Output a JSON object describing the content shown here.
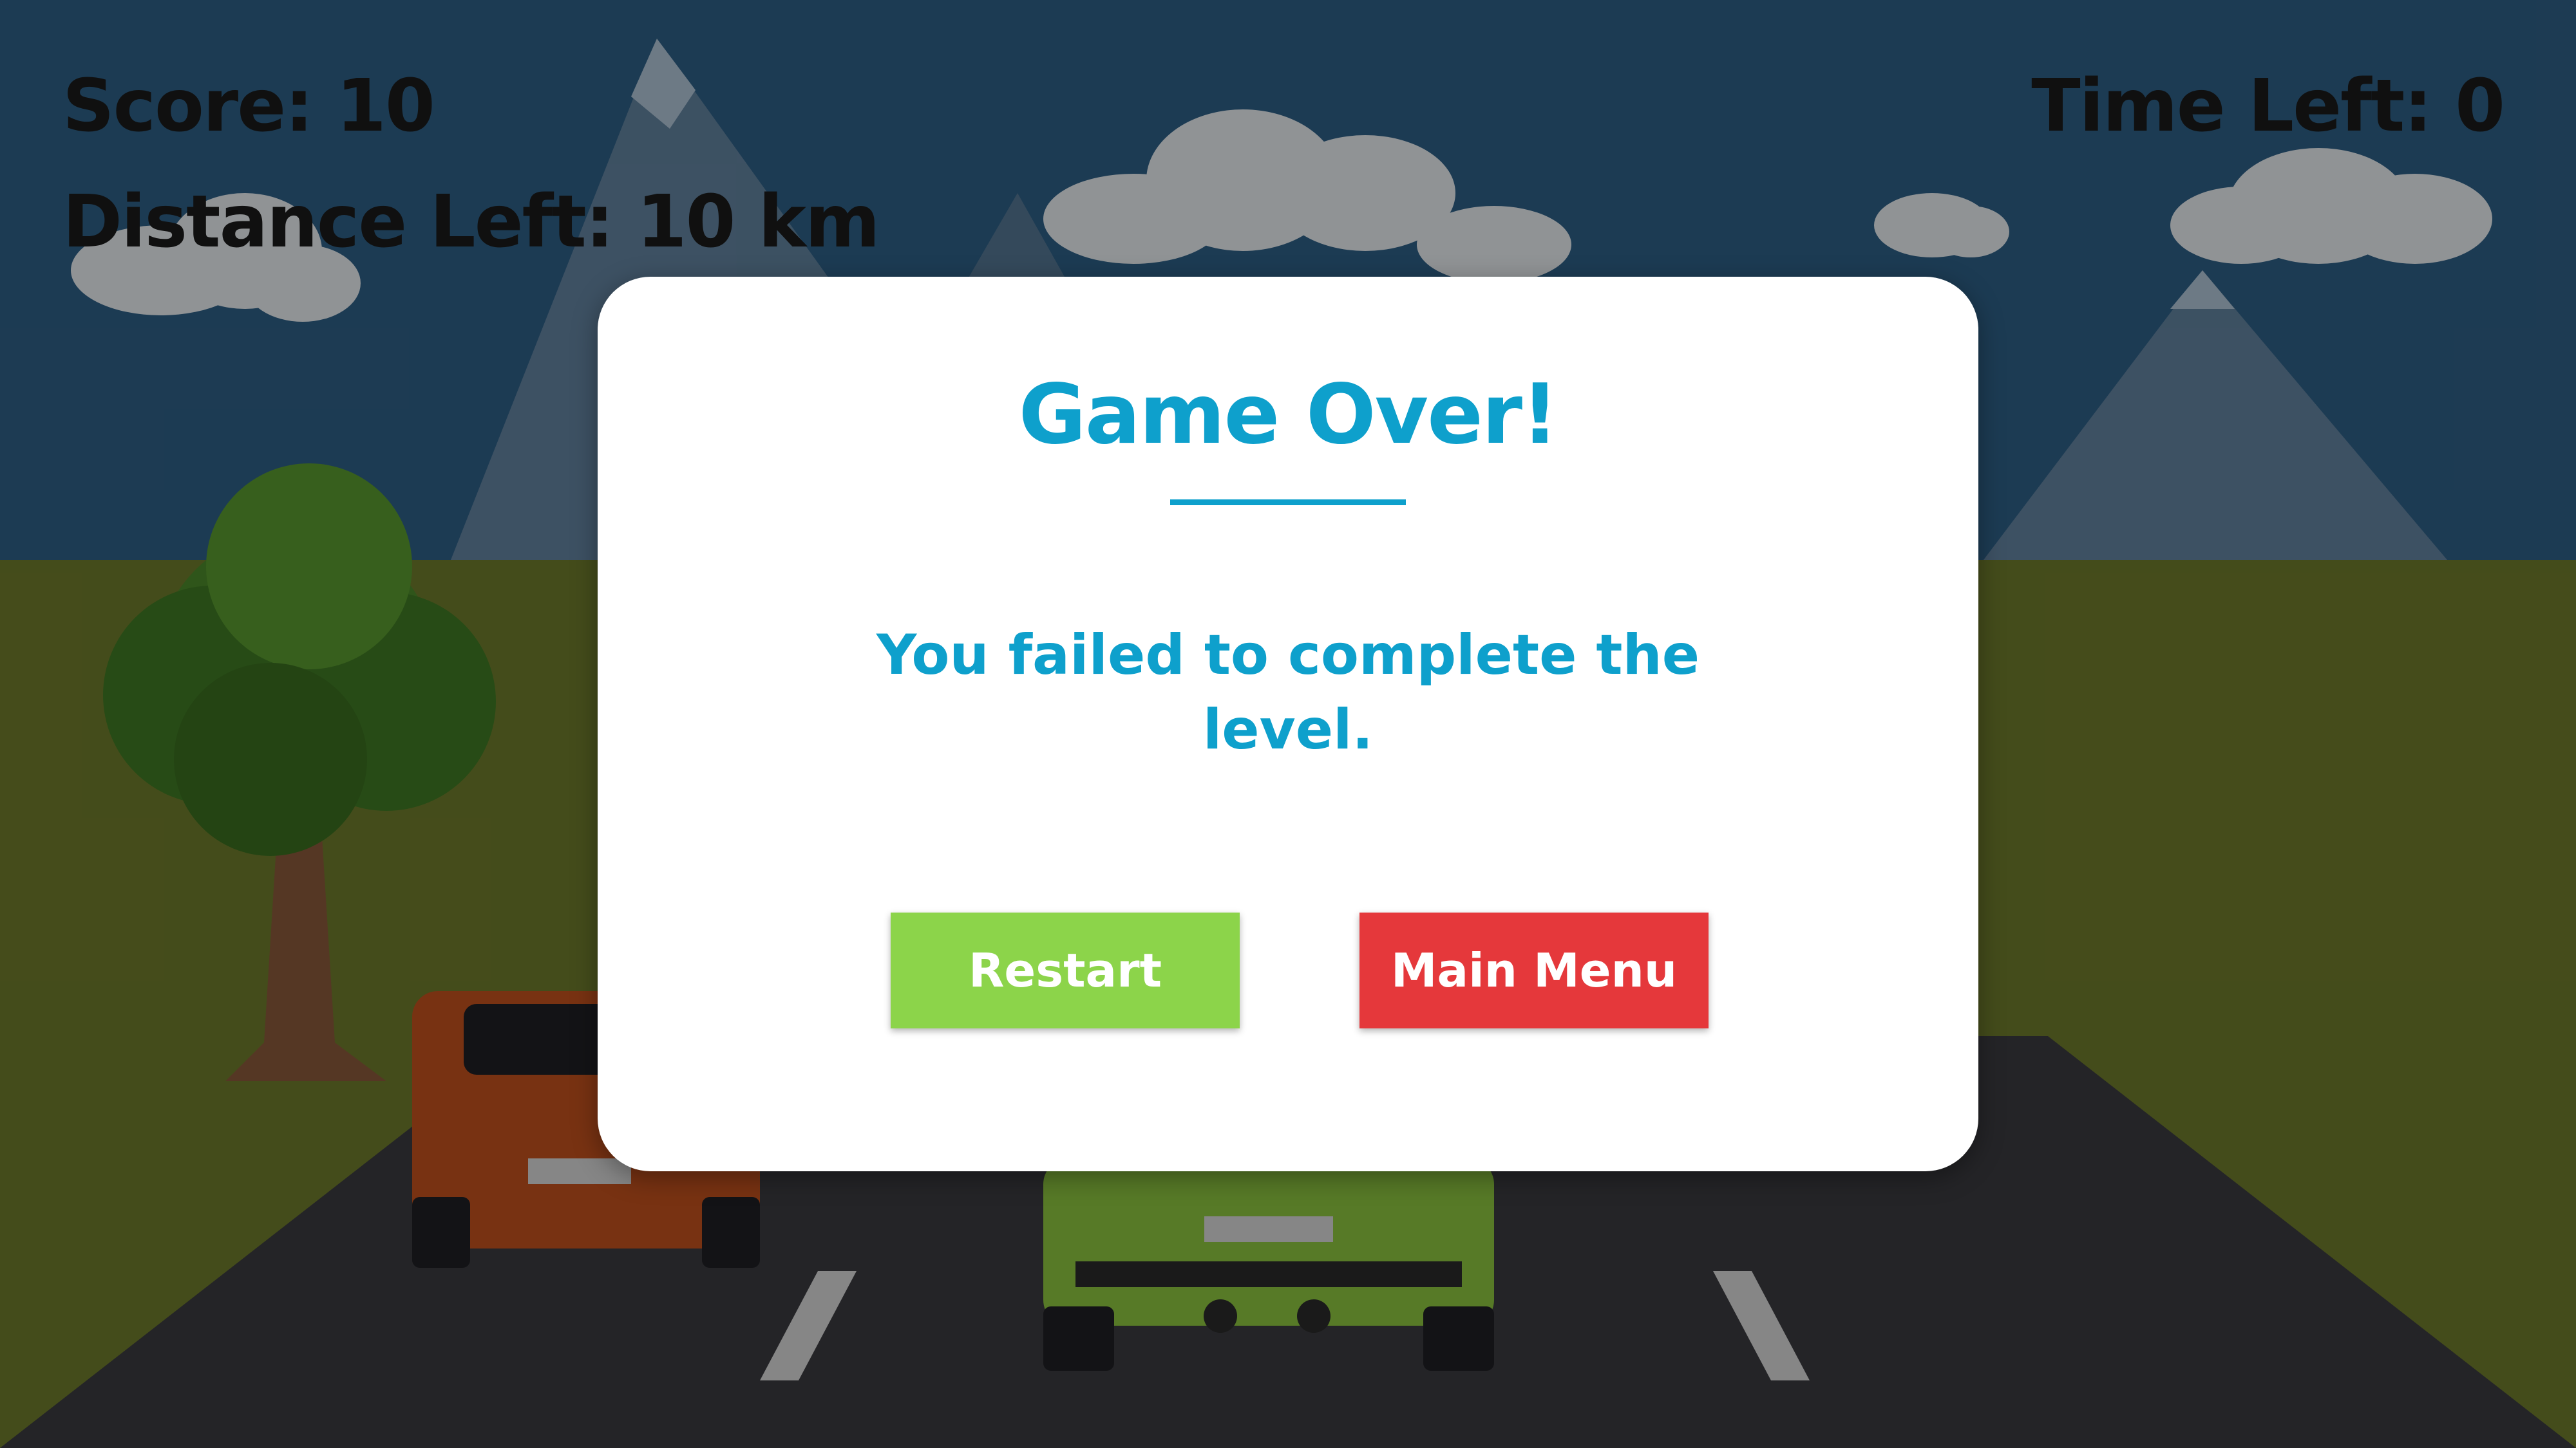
{
  "hud": {
    "score_text": "Score: 10",
    "distance_text": "Distance Left: 10 km",
    "time_text": "Time Left: 0"
  },
  "dialog": {
    "title": "Game Over!",
    "message": "You failed to complete the level.",
    "restart_label": "Restart",
    "main_menu_label": "Main Menu"
  },
  "colors": {
    "sky": "#2e5f86",
    "grass": "#6f7b2c",
    "road": "#3a3a3f",
    "dialog_text": "#0ea0cc",
    "restart_button": "#8cd44a",
    "main_menu_button": "#e5383b"
  }
}
